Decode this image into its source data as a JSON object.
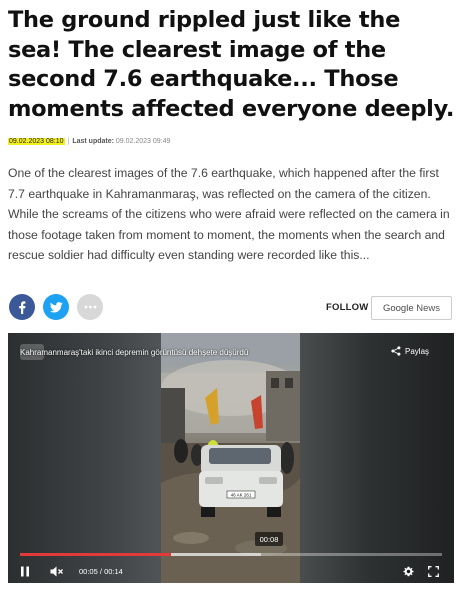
{
  "article": {
    "headline": "The ground rippled just like the sea! The clearest image of the second 7.6 earthquake... Those moments affected everyone deeply.",
    "published": "09.02.2023 08:10",
    "separator": "|",
    "last_update_label": "Last update:",
    "last_update": "09.02.2023 09:49",
    "summary": "One of the clearest images of the 7.6 earthquake, which happened after the first 7.7 earthquake in Kahramanmaraş, was reflected on the camera of the citizen. While the screams of the citizens who were afraid were reflected on the camera in those footage taken from moment to moment, the moments when the search and rescue soldier had difficulty even standing were recorded like this..."
  },
  "share": {
    "buttons": [
      {
        "icon": "facebook-icon",
        "color": "#3b5998"
      },
      {
        "icon": "twitter-icon",
        "color": "#1da1f2"
      },
      {
        "icon": "more-icon",
        "color": "#d8d8d8"
      }
    ]
  },
  "follow": {
    "label": "FOLLOW",
    "google": "Google",
    "news": "News"
  },
  "video": {
    "title": "Kahramanmaraş'taki ikinci depremin görüntüsü dehşete düşürdü",
    "share_label": "Paylaş",
    "hover_time": "00:08",
    "current_time": "00:05",
    "time_separator": "/",
    "duration": "00:14",
    "progress_fraction": 0.357,
    "hover_fraction": 0.571,
    "accent_color": "#e23a3a",
    "car_plate": "46 AK 261"
  }
}
